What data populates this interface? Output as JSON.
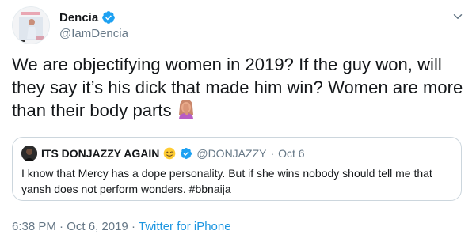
{
  "author": {
    "display_name": "Dencia",
    "handle": "@IamDencia",
    "verified": true
  },
  "tweet": {
    "text": "We are objectifying women in 2019? If the guy won, will they say it’s his dick that made him win? Women are more than their body parts",
    "emoji": "woman-facepalming-icon"
  },
  "quoted_tweet": {
    "display_name": "ITS DONJAZZY AGAIN",
    "name_emoji": "winking-face-icon",
    "verified": true,
    "handle": "@DONJAZZY",
    "separator": "·",
    "date": "Oct 6",
    "text": "I know that Mercy has a dope personality. But if she wins nobody should tell me that yansh does not perform wonders. #bbnaija"
  },
  "meta": {
    "time": "6:38 PM",
    "separator": "·",
    "date": "Oct 6, 2019",
    "separator2": "·",
    "source": "Twitter for iPhone"
  },
  "colors": {
    "text": "#14171a",
    "secondary": "#657786",
    "link": "#1b95e0",
    "verified": "#1da1f2",
    "border": "#ccd6dd"
  }
}
